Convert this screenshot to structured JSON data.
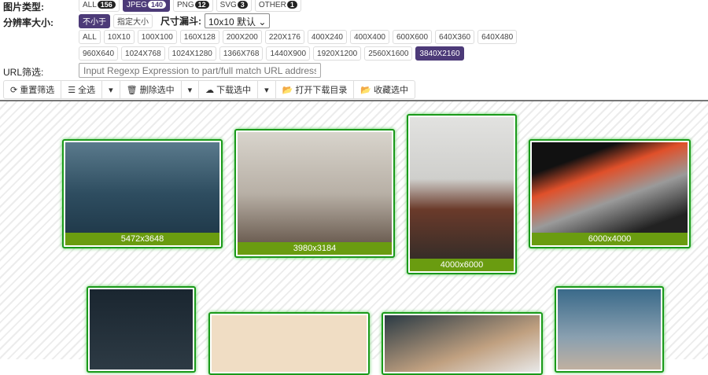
{
  "filters": {
    "type_label": "图片类型:",
    "types": [
      {
        "label": "ALL",
        "count": "156"
      },
      {
        "label": "JPEG",
        "count": "140",
        "selected": true
      },
      {
        "label": "PNG",
        "count": "12"
      },
      {
        "label": "SVG",
        "count": "3"
      },
      {
        "label": "OTHER",
        "count": "1"
      }
    ],
    "resolution_label": "分辨率大小:",
    "mode_min": "不小于",
    "mode_exact": "指定大小",
    "funnel_label": "尺寸漏斗:",
    "funnel_value": "10x10 默认",
    "sizes_row1": [
      "ALL",
      "10X10",
      "100X100",
      "160X128",
      "200X200",
      "220X176",
      "400X240",
      "400X400",
      "600X600",
      "640X360",
      "640X480"
    ],
    "sizes_row2": [
      "960X640",
      "1024X768",
      "1024X1280",
      "1366X768",
      "1440X900",
      "1920X1200",
      "2560X1600",
      "3840X2160"
    ],
    "url_label": "URL筛选:",
    "url_placeholder": "Input Regexp Expression to part/full match URL address."
  },
  "toolbar": {
    "reset": "重置筛选",
    "select_all": "全选",
    "delete": "删除选中",
    "download": "下载选中",
    "open_dir": "打开下载目录",
    "favorite": "收藏选中"
  },
  "images": [
    {
      "size": "5472x3648"
    },
    {
      "size": "3980x3184"
    },
    {
      "size": "4000x6000"
    },
    {
      "size": "6000x4000"
    }
  ]
}
